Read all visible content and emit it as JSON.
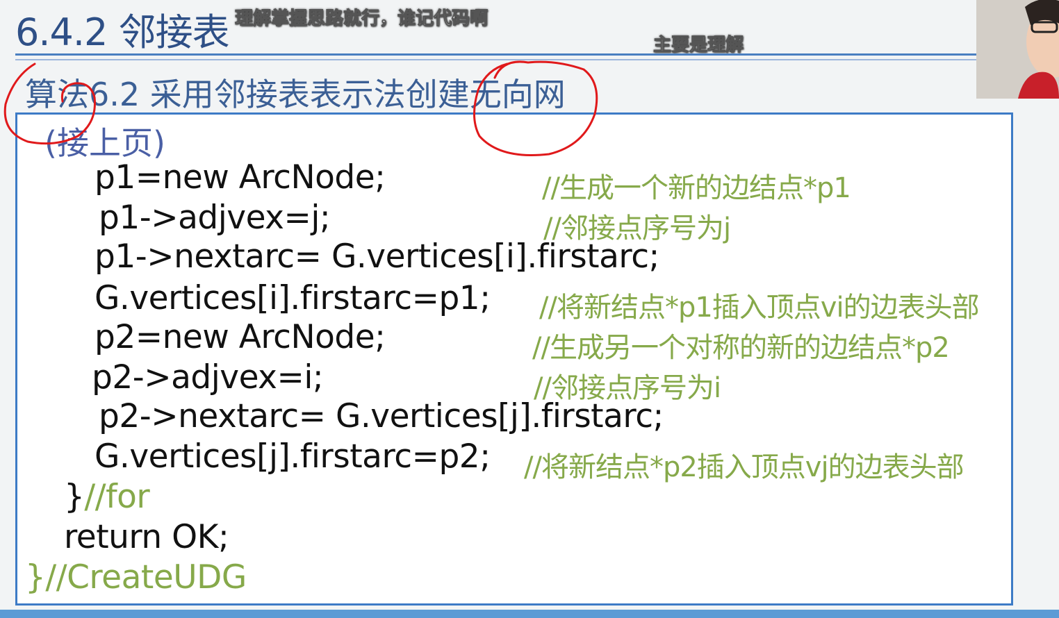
{
  "slide": {
    "section_title": "6.4.2 邻接表",
    "algorithm_title": "算法6.2 采用邻接表表示法创建无向网",
    "continued_label": "(接上页)"
  },
  "subtitles": {
    "line1": "理解掌握思路就行，谁记代码啊",
    "line2": "主要是理解"
  },
  "code": {
    "lines": [
      {
        "code": "p1=new ArcNode;",
        "comment": "//生成一个新的边结点*p1"
      },
      {
        "code": "p1->adjvex=j;",
        "comment": "//邻接点序号为j"
      },
      {
        "code": "p1->nextarc= G.vertices[i].firstarc;",
        "comment": ""
      },
      {
        "code": "G.vertices[i].firstarc=p1;",
        "comment": "//将新结点*p1插入顶点vi的边表头部"
      },
      {
        "code": "p2=new ArcNode;",
        "comment": "//生成另一个对称的新的边结点*p2"
      },
      {
        "code": "p2->adjvex=i;",
        "comment": "//邻接点序号为i"
      },
      {
        "code": "p2->nextarc= G.vertices[j].firstarc;",
        "comment": ""
      },
      {
        "code": "G.vertices[j].firstarc=p2;",
        "comment": "//将新结点*p2插入顶点vj的边表头部"
      }
    ],
    "for_close_brace": "}",
    "for_comment": "//for",
    "return_stmt": "return OK;",
    "func_close_brace": "}",
    "func_comment": "//CreateUDG"
  },
  "colors": {
    "title": "#2e4f86",
    "comment": "#86a94a",
    "border": "#3d7bc6",
    "annotation": "#e0191b"
  },
  "icons": {
    "webcam": "presenter-webcam"
  }
}
